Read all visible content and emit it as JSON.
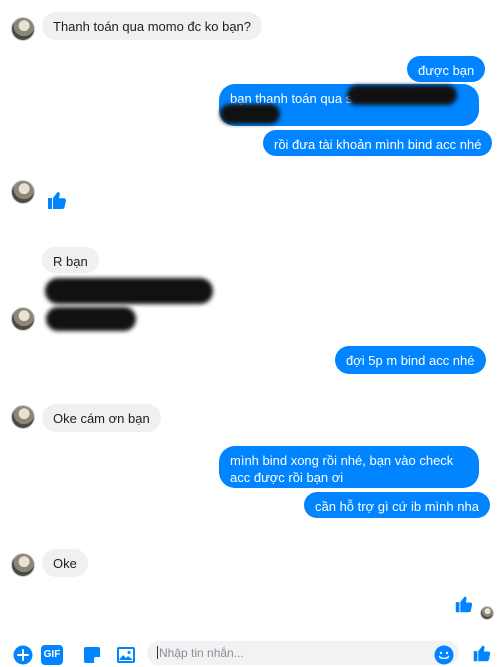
{
  "messages": {
    "m1": "Thanh toán qua momo đc ko bạn?",
    "m2": "được bạn",
    "m3": "bạn thanh toán qua s",
    "m4": "rồi đưa tài khoản mình bind acc nhé",
    "m5": "R bạn",
    "m6": "đợi 5p m bind acc nhé",
    "m7": "Oke cám ơn bạn",
    "m8": "mình bind xong rồi nhé, bạn vào check acc được rồi bạn ơi",
    "m9": "cần hỗ trợ gì cứ ib mình nha",
    "m10": "Oke"
  },
  "composer": {
    "placeholder": "Nhập tin nhắn...",
    "gif_label": "GIF"
  },
  "colors": {
    "accent": "#0084ff",
    "incoming_bubble": "#f1f0f0"
  },
  "icons": [
    "add-icon",
    "gif-icon",
    "sticker-icon",
    "image-icon",
    "emoji-icon",
    "like-icon"
  ]
}
